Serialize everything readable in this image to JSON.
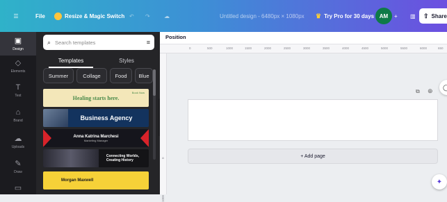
{
  "topbar": {
    "menu_icon": "hamburger-icon",
    "file": "File",
    "resize_label": "Resize & Magic Switch",
    "doc_title": "Untitled design - 6480px × 1080px",
    "try_pro": "Try Pro for 30 days",
    "avatar": "AM",
    "share": "Share"
  },
  "rail": {
    "items": [
      {
        "label": "Design",
        "icon": "design-icon"
      },
      {
        "label": "Elements",
        "icon": "elements-icon"
      },
      {
        "label": "Text",
        "icon": "text-icon"
      },
      {
        "label": "Brand",
        "icon": "brand-icon"
      },
      {
        "label": "Uploads",
        "icon": "upload-icon"
      },
      {
        "label": "Draw",
        "icon": "draw-icon"
      },
      {
        "label": "",
        "icon": "projects-icon"
      }
    ]
  },
  "panel": {
    "search_placeholder": "Search templates",
    "tabs": [
      "Templates",
      "Styles"
    ],
    "chips": [
      "Summer",
      "Collage",
      "Food",
      "Blue"
    ],
    "templates": [
      {
        "title": "Healing starts here.",
        "tag": "Book Now",
        "bg": "#f3e7b9",
        "fg": "#4a8a4a"
      },
      {
        "title": "Business Agency",
        "bg": "#13335e",
        "fg": "#ffffff"
      },
      {
        "title": "Anna Katrina Marchesi",
        "sub": "Marketing Manager",
        "bg": "#15151c",
        "fg": "#ffffff",
        "accent": "#d8232a"
      },
      {
        "title": "Connecting Worlds,",
        "sub": "Creating History",
        "bg": "#141417",
        "fg": "#ffffff",
        "accent": "#ff8a1f"
      },
      {
        "title": "Morgan Maxwell",
        "bg": "#f6d138",
        "fg": "#1a1a1a"
      }
    ]
  },
  "editor": {
    "position_label": "Position",
    "ruler_ticks": [
      "0",
      "500",
      "1000",
      "1500",
      "2000",
      "2500",
      "3000",
      "3500",
      "4000",
      "4500",
      "5000",
      "5500",
      "6000",
      "650"
    ],
    "ruler_vticks": [
      "0",
      "1000"
    ],
    "add_page": "+ Add page"
  }
}
